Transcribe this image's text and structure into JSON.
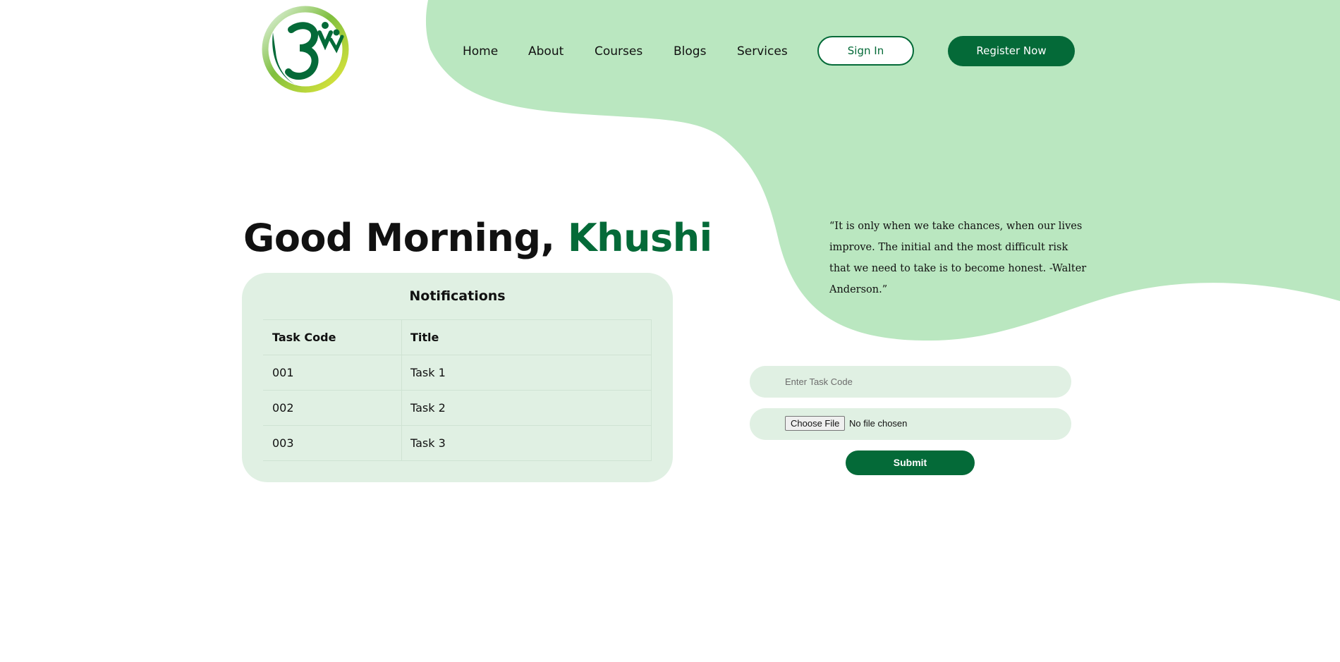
{
  "nav": {
    "links": [
      "Home",
      "About",
      "Courses",
      "Blogs",
      "Services"
    ],
    "signin_label": "Sign In",
    "register_label": "Register Now"
  },
  "greeting": {
    "prefix": "Good Morning,",
    "name": "Khushi"
  },
  "notifications": {
    "title": "Notifications",
    "columns": [
      "Task Code",
      "Title"
    ],
    "rows": [
      [
        "001",
        "Task 1"
      ],
      [
        "002",
        "Task 2"
      ],
      [
        "003",
        "Task 3"
      ]
    ]
  },
  "quote": {
    "text": "“It is only when we take chances, when our lives improve. The initial and the most difficult risk that we need to take is to become honest. -Walter Anderson.”"
  },
  "form": {
    "task_code_placeholder": "Enter Task Code",
    "file_button_label": "Choose File",
    "file_status": "No file chosen",
    "submit_label": "Submit"
  },
  "colors": {
    "brand_green": "#046a38",
    "blob_green": "#bae7c0",
    "card_green": "#e0f0e3",
    "logo_yellow": "#e5e83a"
  },
  "icons": {
    "logo": "om-logo-icon"
  }
}
